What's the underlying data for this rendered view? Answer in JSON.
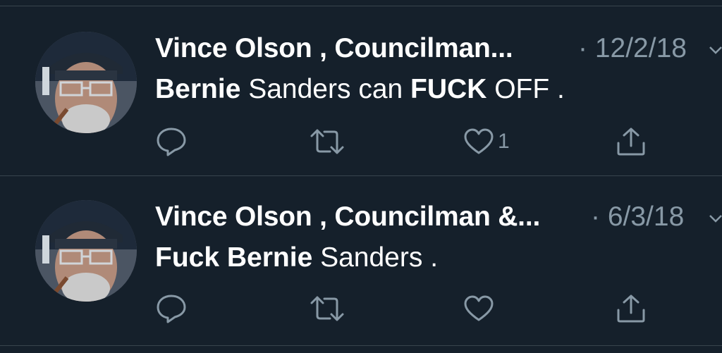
{
  "tweets": [
    {
      "author": "Vince Olson , Councilman...",
      "date": "· 12/2/18",
      "text": [
        {
          "t": "Bernie",
          "bold": true
        },
        {
          "t": " Sanders can ",
          "bold": false
        },
        {
          "t": "FUCK",
          "bold": true
        },
        {
          "t": " OFF .",
          "bold": false
        }
      ],
      "reply_icon": "reply-icon",
      "retweet_icon": "retweet-icon",
      "like_icon": "heart-icon",
      "like_count": "1",
      "share_icon": "share-icon"
    },
    {
      "author": "Vince Olson , Councilman &...",
      "date": "· 6/3/18",
      "text": [
        {
          "t": "Fuck",
          "bold": true
        },
        {
          "t": " ",
          "bold": false
        },
        {
          "t": "Bernie",
          "bold": true
        },
        {
          "t": " Sanders .",
          "bold": false
        }
      ],
      "reply_icon": "reply-icon",
      "retweet_icon": "retweet-icon",
      "like_icon": "heart-icon",
      "like_count": "",
      "share_icon": "share-icon"
    }
  ],
  "colors": {
    "background": "#15202b",
    "muted": "#8899a6",
    "divider": "#38444d",
    "text": "#ffffff"
  }
}
